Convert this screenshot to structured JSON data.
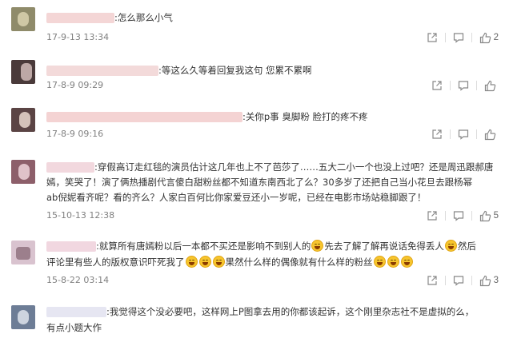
{
  "comments": [
    {
      "text": "怎么那么小气",
      "time": "17-9-13 13:34",
      "likes": "2",
      "name_color": "#f4d6d6",
      "avatar_colors": [
        "#6d6a4e",
        "#a39d7c"
      ]
    },
    {
      "text": "等这么久等着回复我这句 您累不累啊",
      "time": "17-8-9 09:29",
      "likes": "",
      "name_color": "#f3dada",
      "avatar_colors": [
        "#3a2b2b",
        "#b9a3a3"
      ]
    },
    {
      "text": "关你p事 臭脚粉 脸打的疼不疼",
      "time": "17-8-9 09:16",
      "likes": "",
      "name_color": "#f4d3d3",
      "avatar_colors": [
        "#4f3a3a",
        "#c9b8b0"
      ]
    },
    {
      "lines": [
        "穿假高订走红毯的演员估计这几年也上不了芭莎了……五大二小一个也没上过吧？还是周迅跟郝唐",
        "嫣，笑哭了！演了俩热播剧代言傻白甜粉丝都不知道东南西北了么？30多岁了还把自己当小花旦去跟杨幂",
        "ab倪妮看齐呢？看的齐么？人家白百何比你家爱豆还小一岁呢，已经在电影市场站稳脚跟了！"
      ],
      "time": "15-10-13 12:38",
      "likes": "5",
      "name_color": "#f2d8de",
      "avatar_colors": [
        "#7a4f5a",
        "#d9b7bf"
      ]
    },
    {
      "lines": [
        "就算所有唐嫣粉以后一本都不买还是影响不到别人的",
        "先去了解了解再说话免得丢人",
        "然后",
        "评论里有些人的版权意识吓死我了",
        "果然什么样的偶像就有什么样的粉丝"
      ],
      "time": "15-8-22 03:14",
      "likes": "3",
      "name_color": "#f1d7e0",
      "avatar_colors": [
        "#8a7380",
        "#e2cfd8"
      ]
    },
    {
      "lines": [
        "我觉得这个没必要吧，这样网上P图拿去用的你都该起诉，这个刚里杂志社不是虚拟的么，",
        "有点小题大作"
      ],
      "name_color": "#e6e6f2",
      "avatar_colors": [
        "#5b6a80",
        "#c7cfdb"
      ]
    }
  ],
  "icons": {
    "share": "share-icon",
    "comment": "comment-icon",
    "like": "like-icon"
  },
  "separator": ":"
}
